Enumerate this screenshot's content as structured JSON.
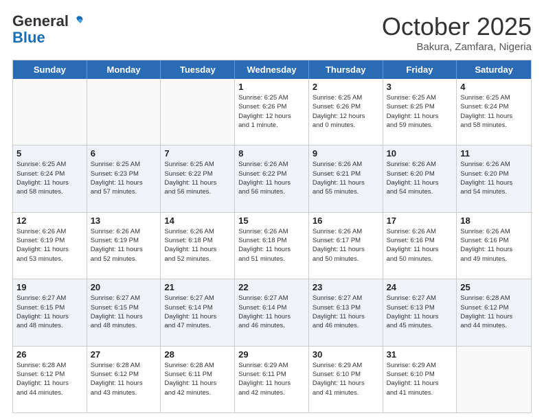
{
  "header": {
    "logo_general": "General",
    "logo_blue": "Blue",
    "month_title": "October 2025",
    "location": "Bakura, Zamfara, Nigeria"
  },
  "days_of_week": [
    "Sunday",
    "Monday",
    "Tuesday",
    "Wednesday",
    "Thursday",
    "Friday",
    "Saturday"
  ],
  "weeks": [
    {
      "alt": false,
      "cells": [
        {
          "day": "",
          "info": ""
        },
        {
          "day": "",
          "info": ""
        },
        {
          "day": "",
          "info": ""
        },
        {
          "day": "1",
          "info": "Sunrise: 6:25 AM\nSunset: 6:26 PM\nDaylight: 12 hours\nand 1 minute."
        },
        {
          "day": "2",
          "info": "Sunrise: 6:25 AM\nSunset: 6:26 PM\nDaylight: 12 hours\nand 0 minutes."
        },
        {
          "day": "3",
          "info": "Sunrise: 6:25 AM\nSunset: 6:25 PM\nDaylight: 11 hours\nand 59 minutes."
        },
        {
          "day": "4",
          "info": "Sunrise: 6:25 AM\nSunset: 6:24 PM\nDaylight: 11 hours\nand 58 minutes."
        }
      ]
    },
    {
      "alt": true,
      "cells": [
        {
          "day": "5",
          "info": "Sunrise: 6:25 AM\nSunset: 6:24 PM\nDaylight: 11 hours\nand 58 minutes."
        },
        {
          "day": "6",
          "info": "Sunrise: 6:25 AM\nSunset: 6:23 PM\nDaylight: 11 hours\nand 57 minutes."
        },
        {
          "day": "7",
          "info": "Sunrise: 6:25 AM\nSunset: 6:22 PM\nDaylight: 11 hours\nand 56 minutes."
        },
        {
          "day": "8",
          "info": "Sunrise: 6:26 AM\nSunset: 6:22 PM\nDaylight: 11 hours\nand 56 minutes."
        },
        {
          "day": "9",
          "info": "Sunrise: 6:26 AM\nSunset: 6:21 PM\nDaylight: 11 hours\nand 55 minutes."
        },
        {
          "day": "10",
          "info": "Sunrise: 6:26 AM\nSunset: 6:20 PM\nDaylight: 11 hours\nand 54 minutes."
        },
        {
          "day": "11",
          "info": "Sunrise: 6:26 AM\nSunset: 6:20 PM\nDaylight: 11 hours\nand 54 minutes."
        }
      ]
    },
    {
      "alt": false,
      "cells": [
        {
          "day": "12",
          "info": "Sunrise: 6:26 AM\nSunset: 6:19 PM\nDaylight: 11 hours\nand 53 minutes."
        },
        {
          "day": "13",
          "info": "Sunrise: 6:26 AM\nSunset: 6:19 PM\nDaylight: 11 hours\nand 52 minutes."
        },
        {
          "day": "14",
          "info": "Sunrise: 6:26 AM\nSunset: 6:18 PM\nDaylight: 11 hours\nand 52 minutes."
        },
        {
          "day": "15",
          "info": "Sunrise: 6:26 AM\nSunset: 6:18 PM\nDaylight: 11 hours\nand 51 minutes."
        },
        {
          "day": "16",
          "info": "Sunrise: 6:26 AM\nSunset: 6:17 PM\nDaylight: 11 hours\nand 50 minutes."
        },
        {
          "day": "17",
          "info": "Sunrise: 6:26 AM\nSunset: 6:16 PM\nDaylight: 11 hours\nand 50 minutes."
        },
        {
          "day": "18",
          "info": "Sunrise: 6:26 AM\nSunset: 6:16 PM\nDaylight: 11 hours\nand 49 minutes."
        }
      ]
    },
    {
      "alt": true,
      "cells": [
        {
          "day": "19",
          "info": "Sunrise: 6:27 AM\nSunset: 6:15 PM\nDaylight: 11 hours\nand 48 minutes."
        },
        {
          "day": "20",
          "info": "Sunrise: 6:27 AM\nSunset: 6:15 PM\nDaylight: 11 hours\nand 48 minutes."
        },
        {
          "day": "21",
          "info": "Sunrise: 6:27 AM\nSunset: 6:14 PM\nDaylight: 11 hours\nand 47 minutes."
        },
        {
          "day": "22",
          "info": "Sunrise: 6:27 AM\nSunset: 6:14 PM\nDaylight: 11 hours\nand 46 minutes."
        },
        {
          "day": "23",
          "info": "Sunrise: 6:27 AM\nSunset: 6:13 PM\nDaylight: 11 hours\nand 46 minutes."
        },
        {
          "day": "24",
          "info": "Sunrise: 6:27 AM\nSunset: 6:13 PM\nDaylight: 11 hours\nand 45 minutes."
        },
        {
          "day": "25",
          "info": "Sunrise: 6:28 AM\nSunset: 6:12 PM\nDaylight: 11 hours\nand 44 minutes."
        }
      ]
    },
    {
      "alt": false,
      "cells": [
        {
          "day": "26",
          "info": "Sunrise: 6:28 AM\nSunset: 6:12 PM\nDaylight: 11 hours\nand 44 minutes."
        },
        {
          "day": "27",
          "info": "Sunrise: 6:28 AM\nSunset: 6:12 PM\nDaylight: 11 hours\nand 43 minutes."
        },
        {
          "day": "28",
          "info": "Sunrise: 6:28 AM\nSunset: 6:11 PM\nDaylight: 11 hours\nand 42 minutes."
        },
        {
          "day": "29",
          "info": "Sunrise: 6:29 AM\nSunset: 6:11 PM\nDaylight: 11 hours\nand 42 minutes."
        },
        {
          "day": "30",
          "info": "Sunrise: 6:29 AM\nSunset: 6:10 PM\nDaylight: 11 hours\nand 41 minutes."
        },
        {
          "day": "31",
          "info": "Sunrise: 6:29 AM\nSunset: 6:10 PM\nDaylight: 11 hours\nand 41 minutes."
        },
        {
          "day": "",
          "info": ""
        }
      ]
    }
  ]
}
